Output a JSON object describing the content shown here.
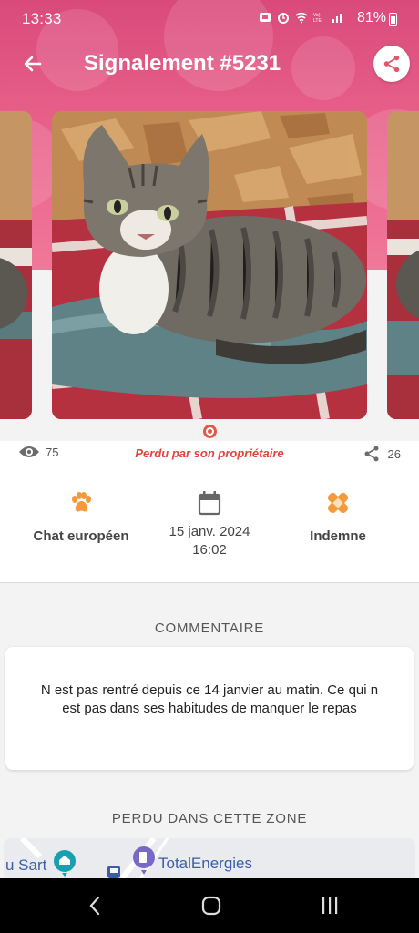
{
  "status_bar": {
    "time": "13:33",
    "battery": "81%"
  },
  "app_bar": {
    "title": "Signalement #5231"
  },
  "stats": {
    "views": "75",
    "status": "Perdu par son propriétaire",
    "shares": "26"
  },
  "details": {
    "breed": "Chat européen",
    "date": "15 janv. 2024",
    "time": "16:02",
    "condition": "Indemne"
  },
  "comment": {
    "section_title": "COMMENTAIRE",
    "text": "N est pas rentré depuis ce 14 janvier au matin. Ce qui n est pas dans ses habitudes de manquer le repas"
  },
  "zone": {
    "section_title": "PERDU DANS CETTE ZONE",
    "map_label_left": "u Sart",
    "map_label_poi": "TotalEnergies"
  },
  "colors": {
    "accent": "#e0443b",
    "header": "#e35b86",
    "icon_orange": "#f39a3c"
  },
  "icons": [
    "back-arrow-icon",
    "share-icon",
    "eye-icon",
    "share-icon",
    "paw-icon",
    "calendar-icon",
    "bandage-icon"
  ]
}
